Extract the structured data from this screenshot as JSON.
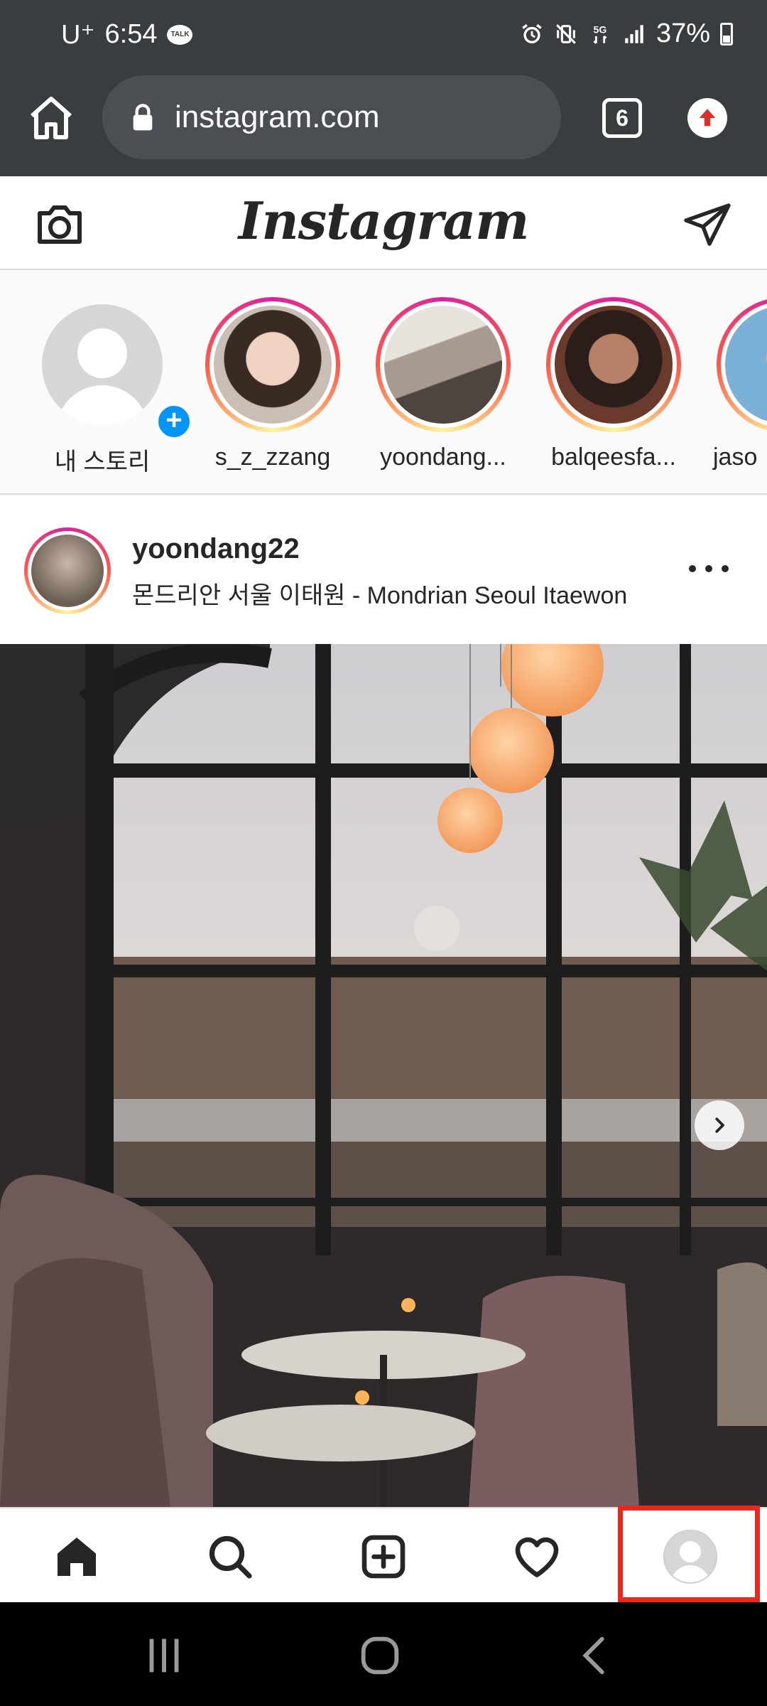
{
  "status_bar": {
    "carrier": "U⁺",
    "time": "6:54",
    "talk_badge": "TALK",
    "battery": "37%",
    "icons": [
      "alarm-icon",
      "vibrate-mute-icon",
      "5g-icon",
      "signal-icon",
      "battery-icon"
    ]
  },
  "browser": {
    "url": "instagram.com",
    "tab_count": "6",
    "icons": [
      "home-icon",
      "lock-icon",
      "update-icon"
    ]
  },
  "instagram": {
    "logo": "Instagram",
    "header_icons": [
      "camera-icon",
      "direct-message-icon"
    ]
  },
  "stories": [
    {
      "label": "내 스토리"
    },
    {
      "label": "s_z_zzang"
    },
    {
      "label": "yoondang..."
    },
    {
      "label": "balqeesfa..."
    },
    {
      "label": "jaso"
    }
  ],
  "post": {
    "username": "yoondang22",
    "location": "몬드리안 서울 이태원 - Mondrian Seoul Itaewon"
  },
  "bottom_nav": [
    "home-icon",
    "search-icon",
    "new-post-icon",
    "activity-heart-icon",
    "profile-icon"
  ],
  "colors": {
    "chrome_bg": "#3a3d40",
    "story_gradient": [
      "#d6249f",
      "#fd5949",
      "#fdf497"
    ],
    "accent_blue": "#0095f6",
    "highlight_red": "#e8281c"
  }
}
